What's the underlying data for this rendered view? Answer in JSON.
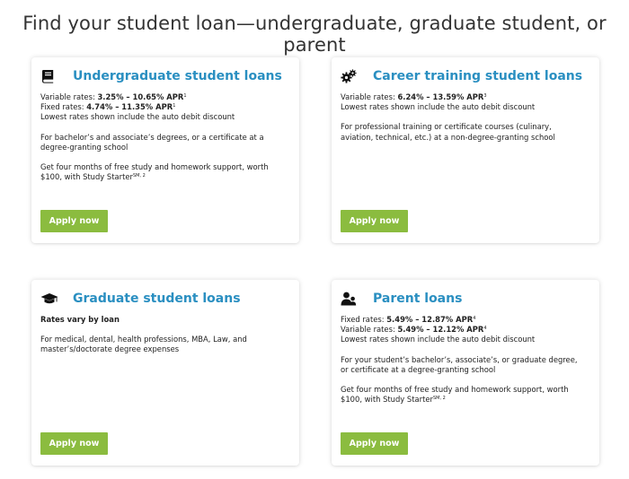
{
  "page": {
    "title": "Find your student loan—undergraduate, graduate student, or parent"
  },
  "colors": {
    "title_blue": "#2a8fc1",
    "button_green": "#8bbc3f"
  },
  "cards": [
    {
      "title": "Undergraduate student loans",
      "icon": "book-icon",
      "rate1_label": "Variable rates: ",
      "rate1_value": "3.25% – 10.65% APR",
      "rate1_sup": "1",
      "rate2_label": "Fixed rates: ",
      "rate2_value": "4.74% – 11.35% APR",
      "rate2_sup": "1",
      "discount": "Lowest rates shown include the auto debit discount",
      "desc_1": "For bachelor’s and associate’s degrees, or a certificate at a",
      "desc_2": "degree-granting school",
      "promo_1": "Get four months of free study and homework support, worth",
      "promo_2": "$100, with Study Starter",
      "promo_sup": "SM, 2",
      "button": "Apply now"
    },
    {
      "title": "Career training student loans",
      "icon": "gears-icon",
      "rate1_label": "Variable rates: ",
      "rate1_value": "6.24% – 13.59% APR",
      "rate1_sup": "3",
      "discount": "Lowest rates shown include the auto debit discount",
      "desc_1": "For professional training or certificate courses (culinary,",
      "desc_2": "aviation, technical, etc.) at a non-degree-granting school",
      "button": "Apply now"
    },
    {
      "title": "Graduate student loans",
      "icon": "graduation-cap-icon",
      "rates_note": "Rates vary by loan",
      "desc_1": "For medical, dental, health professions, MBA, Law, and",
      "desc_2": "master’s/doctorate degree expenses",
      "button": "Apply now"
    },
    {
      "title": "Parent loans",
      "icon": "parent-child-icon",
      "rate1_label": "Fixed rates: ",
      "rate1_value": "5.49% – 12.87% APR",
      "rate1_sup": "4",
      "rate2_label": "Variable rates: ",
      "rate2_value": "5.49% – 12.12% APR",
      "rate2_sup": "4",
      "discount": "Lowest rates shown include the auto debit discount",
      "desc_1": "For your student’s bachelor’s, associate’s, or graduate degree,",
      "desc_2": "or certificate at a degree-granting school",
      "promo_1": "Get four months of free study and homework support, worth",
      "promo_2": "$100, with Study Starter",
      "promo_sup": "SM, 2",
      "button": "Apply now"
    }
  ]
}
